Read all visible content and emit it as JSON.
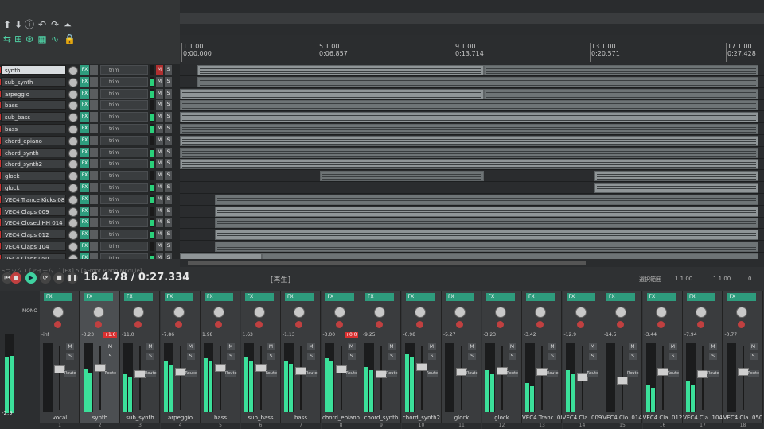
{
  "ruler": [
    {
      "bar": "1.1.00",
      "time": "0:00.000"
    },
    {
      "bar": "5.1.00",
      "time": "0:06.857"
    },
    {
      "bar": "9.1.00",
      "time": "0:13.714"
    },
    {
      "bar": "13.1.00",
      "time": "0:20.571"
    },
    {
      "bar": "17.1.00",
      "time": "0:27.428"
    }
  ],
  "tracks": [
    {
      "name": "synth",
      "selected": true,
      "items": [
        [
          0.03,
          0.52
        ],
        [
          0.52,
          0.99
        ]
      ]
    },
    {
      "name": "sub_synth",
      "selected": false,
      "items": [
        [
          0.03,
          0.99
        ]
      ]
    },
    {
      "name": "arpeggio",
      "selected": false,
      "items": [
        [
          0.0,
          0.52
        ],
        [
          0.52,
          0.99
        ]
      ]
    },
    {
      "name": "bass",
      "selected": false,
      "items": [
        [
          0.0,
          0.99
        ]
      ]
    },
    {
      "name": "sub_bass",
      "selected": false,
      "items": [
        [
          0.0,
          0.99
        ]
      ]
    },
    {
      "name": "bass",
      "selected": false,
      "items": [
        [
          0.0,
          0.99
        ]
      ]
    },
    {
      "name": "chord_epiano",
      "selected": false,
      "items": [
        [
          0.0,
          0.99
        ]
      ]
    },
    {
      "name": "chord_synth",
      "selected": false,
      "items": [
        [
          0.0,
          0.99
        ]
      ]
    },
    {
      "name": "chord_synth2",
      "selected": false,
      "items": [
        [
          0.0,
          0.99
        ]
      ]
    },
    {
      "name": "glock",
      "selected": false,
      "items": [
        [
          0.24,
          0.52
        ],
        [
          0.71,
          0.99
        ]
      ]
    },
    {
      "name": "glock",
      "selected": false,
      "items": [
        [
          0.71,
          0.99
        ]
      ]
    },
    {
      "name": "VEC4 Trance Kicks 08",
      "selected": false,
      "items": [
        [
          0.06,
          0.99
        ]
      ]
    },
    {
      "name": "VEC4 Claps 009",
      "selected": false,
      "items": [
        [
          0.06,
          0.99
        ]
      ]
    },
    {
      "name": "VEC4 Closed HH 014",
      "selected": false,
      "items": [
        [
          0.06,
          0.99
        ]
      ]
    },
    {
      "name": "VEC4 Claps 012",
      "selected": false,
      "items": [
        [
          0.06,
          0.99
        ]
      ]
    },
    {
      "name": "VEC4 Claps 104",
      "selected": false,
      "items": [
        [
          0.06,
          0.99
        ]
      ]
    },
    {
      "name": "VEC4 Claps 050",
      "selected": false,
      "items": [
        [
          0.0,
          0.14
        ],
        [
          0.14,
          0.99
        ]
      ]
    }
  ],
  "track_button_labels": {
    "fx": "FX",
    "mute": "M",
    "solo": "S",
    "trim": "trim"
  },
  "transport": {
    "track_label": "トラック 1 [アイテム 1] [FX] 5 [AFront Piano Module]",
    "position": "16.4.78 / 0:27.334",
    "state": "[再生]",
    "selection_label": "選択範囲",
    "selection_start": "1.1.00",
    "selection_end": "1.1.00",
    "selection_length": "0"
  },
  "mixer": {
    "fx_label": "FX",
    "mute": "M",
    "solo": "S",
    "route": "Route",
    "mono": "MONO",
    "master": {
      "name": "",
      "vol": "-2.9",
      "num": ""
    },
    "strips": [
      {
        "name": "vocal",
        "num": "1",
        "vol": "-inf",
        "peak": "",
        "level": 0,
        "fader": 0.7
      },
      {
        "name": "synth",
        "num": "2",
        "vol": "-3.23",
        "peak": "+1.6",
        "level": 0.62,
        "fader": 0.72,
        "selected": true
      },
      {
        "name": "sub_synth",
        "num": "3",
        "vol": "-11.0",
        "peak": "",
        "level": 0.55,
        "fader": 0.62
      },
      {
        "name": "arpeggio",
        "num": "4",
        "vol": "-7.86",
        "peak": "",
        "level": 0.73,
        "fader": 0.66
      },
      {
        "name": "bass",
        "num": "5",
        "vol": "1.98",
        "peak": "",
        "level": 0.78,
        "fader": 0.72
      },
      {
        "name": "sub_bass",
        "num": "6",
        "vol": "1.63",
        "peak": "",
        "level": 0.8,
        "fader": 0.72
      },
      {
        "name": "bass",
        "num": "7",
        "vol": "-1.13",
        "peak": "",
        "level": 0.75,
        "fader": 0.68
      },
      {
        "name": "chord_epiano",
        "num": "8",
        "vol": "-3.00",
        "peak": "+0.0",
        "level": 0.78,
        "fader": 0.7
      },
      {
        "name": "chord_synth",
        "num": "9",
        "vol": "-9.25",
        "peak": "",
        "level": 0.65,
        "fader": 0.62
      },
      {
        "name": "chord_synth2",
        "num": "10",
        "vol": "-0.98",
        "peak": "",
        "level": 0.85,
        "fader": 0.74
      },
      {
        "name": "glock",
        "num": "11",
        "vol": "-5.27",
        "peak": "",
        "level": 0,
        "fader": 0.66
      },
      {
        "name": "glock",
        "num": "12",
        "vol": "-3.23",
        "peak": "",
        "level": 0.6,
        "fader": 0.68
      },
      {
        "name": "VEC4 Tranc..08",
        "num": "13",
        "vol": "-3.42",
        "peak": "",
        "level": 0.42,
        "fader": 0.66
      },
      {
        "name": "VEC4 Cla..009",
        "num": "14",
        "vol": "-12.9",
        "peak": "",
        "level": 0.6,
        "fader": 0.58
      },
      {
        "name": "VEC4 Clo..014",
        "num": "15",
        "vol": "-14.5",
        "peak": "",
        "level": 0,
        "fader": 0.52
      },
      {
        "name": "VEC4 Cla..012",
        "num": "16",
        "vol": "-3.44",
        "peak": "",
        "level": 0.4,
        "fader": 0.66
      },
      {
        "name": "VEC4 Cla..104",
        "num": "17",
        "vol": "-7.94",
        "peak": "",
        "level": 0.45,
        "fader": 0.62
      },
      {
        "name": "VEC4 Cla..050",
        "num": "18",
        "vol": "-0.77",
        "peak": "",
        "level": 0,
        "fader": 0.66
      }
    ]
  }
}
